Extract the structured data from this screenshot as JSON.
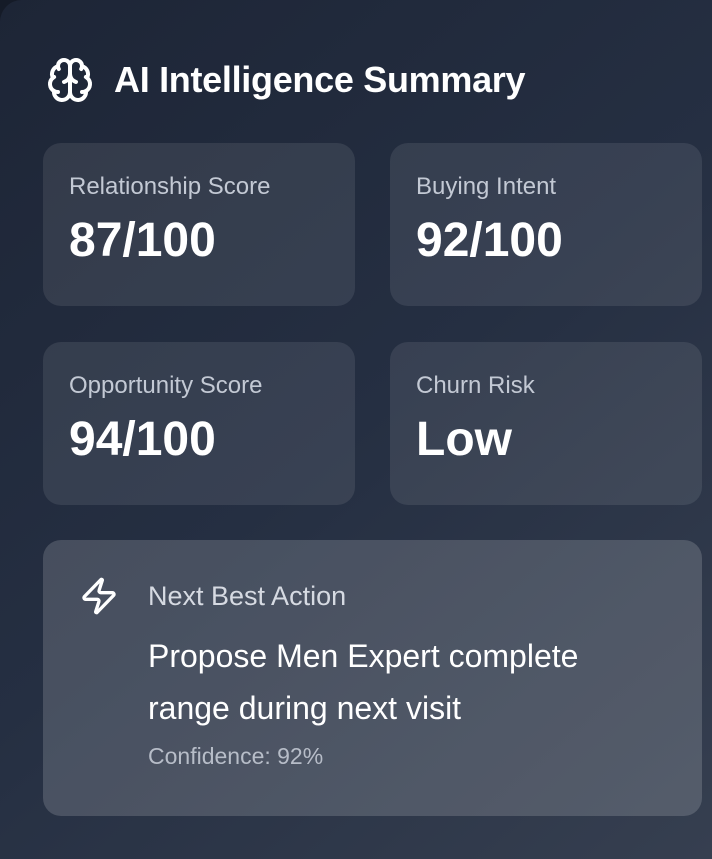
{
  "header": {
    "icon": "brain-icon",
    "title": "AI Intelligence Summary"
  },
  "metrics": [
    {
      "label": "Relationship Score",
      "value": "87/100"
    },
    {
      "label": "Buying Intent",
      "value": "92/100"
    },
    {
      "label": "Opportunity Score",
      "value": "94/100"
    },
    {
      "label": "Churn Risk",
      "value": "Low"
    }
  ],
  "next_action": {
    "icon": "lightning-bolt-icon",
    "label": "Next Best Action",
    "text": "Propose Men Expert complete range during next visit",
    "confidence": "Confidence: 92%"
  },
  "colors": {
    "background": "#1d2536",
    "card": "#2e3646",
    "text": "#ffffff",
    "muted": "#c3c9d4"
  }
}
